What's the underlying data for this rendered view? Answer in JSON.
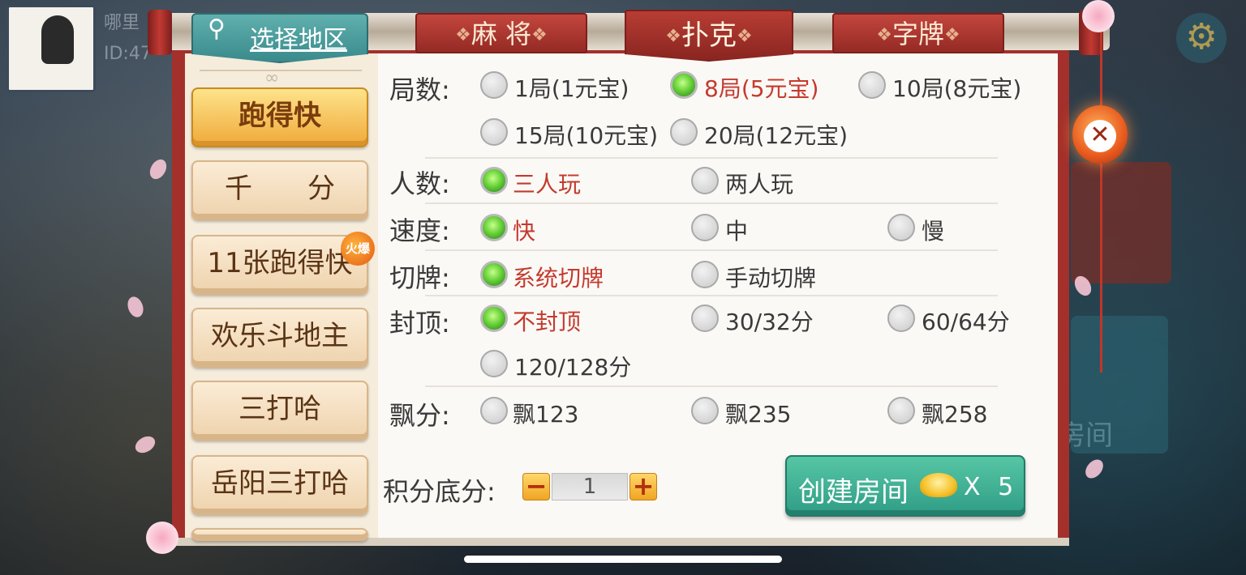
{
  "background": {
    "user_name": "哪里",
    "user_id": "ID:47",
    "ghost_text": "房间",
    "settings_icon": "gear-icon"
  },
  "region": {
    "label": "选择地区",
    "icon": "location-pin-icon"
  },
  "tabs": [
    {
      "label": "麻 将",
      "active": false
    },
    {
      "label": "扑克",
      "active": true
    },
    {
      "label": "字牌",
      "active": false
    }
  ],
  "games": [
    {
      "label": "跑得快",
      "active": true
    },
    {
      "label": "千　　分",
      "active": false
    },
    {
      "label": "11张跑得快",
      "active": false,
      "badge": "火爆"
    },
    {
      "label": "欢乐斗地主",
      "active": false
    },
    {
      "label": "三打哈",
      "active": false
    },
    {
      "label": "岳阳三打哈",
      "active": false
    }
  ],
  "options": {
    "rounds": {
      "label": "局数:",
      "items": [
        "1局(1元宝)",
        "8局(5元宝)",
        "10局(8元宝)",
        "15局(10元宝)",
        "20局(12元宝)"
      ],
      "selected": 1
    },
    "players": {
      "label": "人数:",
      "items": [
        "三人玩",
        "两人玩"
      ],
      "selected": 0
    },
    "speed": {
      "label": "速度:",
      "items": [
        "快",
        "中",
        "慢"
      ],
      "selected": 0
    },
    "cut": {
      "label": "切牌:",
      "items": [
        "系统切牌",
        "手动切牌"
      ],
      "selected": 0
    },
    "cap": {
      "label": "封顶:",
      "items": [
        "不封顶",
        "30/32分",
        "60/64分",
        "120/128分"
      ],
      "selected": 0
    },
    "float": {
      "label": "飘分:",
      "items": [
        "飘123",
        "飘235",
        "飘258"
      ],
      "selected": -1
    }
  },
  "score": {
    "label": "积分底分:",
    "value": "1",
    "minus": "−",
    "plus": "+"
  },
  "create": {
    "label": "创建房间",
    "cost": "X 5",
    "icon": "gold-ingot-icon"
  },
  "close": {
    "symbol": "✕"
  },
  "colors": {
    "accent_red": "#a3302b",
    "selected_text": "#c43a2e",
    "create_green": "#2f9d86"
  }
}
